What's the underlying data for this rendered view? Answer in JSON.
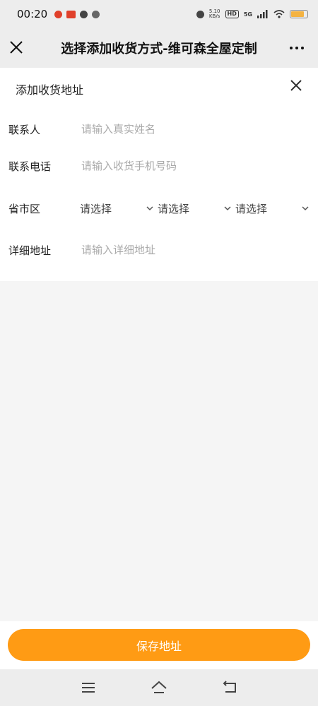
{
  "status": {
    "time": "00:20",
    "net_speed": "5.10",
    "net_unit": "KB/s",
    "hd": "HD",
    "signal": "5G",
    "battery_level": 0.85
  },
  "titlebar": {
    "title": "选择添加收货方式-维可森全屋定制"
  },
  "form": {
    "header": "添加收货地址",
    "contact": {
      "label": "联系人",
      "placeholder": "请输入真实姓名"
    },
    "phone": {
      "label": "联系电话",
      "placeholder": "请输入收货手机号码"
    },
    "region": {
      "label": "省市区",
      "province": "请选择",
      "city": "请选择",
      "district": "请选择"
    },
    "address": {
      "label": "详细地址",
      "placeholder": "请输入详细地址"
    }
  },
  "save": {
    "label": "保存地址"
  },
  "colors": {
    "accent": "#ff9b14"
  },
  "icons": {
    "close": "close-icon",
    "more": "more-icon",
    "chevron": "chevron-down-icon",
    "menu": "menu-icon",
    "home": "home-icon",
    "back": "back-icon"
  }
}
